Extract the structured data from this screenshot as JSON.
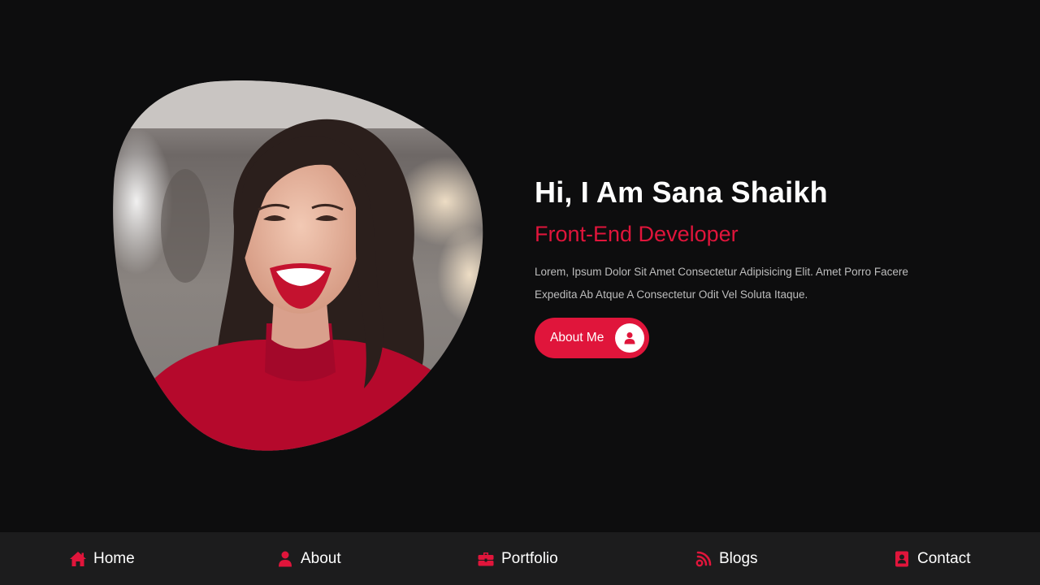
{
  "theme": {
    "background": "#0d0d0e",
    "accent": "#e0153b",
    "nav_background": "#1c1c1d",
    "text_primary": "#ffffff",
    "text_muted": "#bdbdbd"
  },
  "hero": {
    "photo_icon": "portrait-photo",
    "title": "Hi, I Am Sana Shaikh",
    "subtitle": "Front-End Developer",
    "description": "Lorem, Ipsum Dolor Sit Amet Consectetur Adipisicing Elit. Amet Porro Facere Expedita Ab Atque A Consectetur Odit Vel Soluta Itaque.",
    "button": {
      "label": "About Me",
      "icon": "user-icon"
    }
  },
  "nav": {
    "items": [
      {
        "label": "Home",
        "icon": "home-icon"
      },
      {
        "label": "About",
        "icon": "user-icon"
      },
      {
        "label": "Portfolio",
        "icon": "briefcase-icon"
      },
      {
        "label": "Blogs",
        "icon": "blog-icon"
      },
      {
        "label": "Contact",
        "icon": "address-book-icon"
      }
    ]
  }
}
